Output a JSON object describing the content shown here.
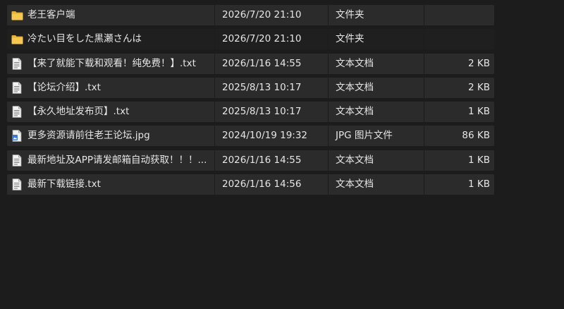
{
  "files": [
    {
      "name": "老王客户端",
      "date": "2026/7/20 21:10",
      "type": "文件夹",
      "size": "",
      "icon": "folder-icon",
      "row_style": "dark"
    },
    {
      "name": "冷たい目をした黒瀬さんは",
      "date": "2026/7/20 21:10",
      "type": "文件夹",
      "size": "",
      "icon": "folder-icon",
      "row_style": "alt"
    },
    {
      "name": "【来了就能下载和观看！纯免费！】.txt",
      "date": "2026/1/16 14:55",
      "type": "文本文档",
      "size": "2 KB",
      "icon": "text-file-icon",
      "row_style": "dark"
    },
    {
      "name": "【论坛介绍】.txt",
      "date": "2025/8/13 10:17",
      "type": "文本文档",
      "size": "2 KB",
      "icon": "text-file-icon",
      "row_style": "dark"
    },
    {
      "name": "【永久地址发布页】.txt",
      "date": "2025/8/13 10:17",
      "type": "文本文档",
      "size": "1 KB",
      "icon": "text-file-icon",
      "row_style": "dark"
    },
    {
      "name": "更多资源请前往老王论坛.jpg",
      "date": "2024/10/19 19:32",
      "type": "JPG 图片文件",
      "size": "86 KB",
      "icon": "image-file-icon",
      "row_style": "dark"
    },
    {
      "name": "最新地址及APP请发邮箱自动获取！！！...",
      "date": "2026/1/16 14:55",
      "type": "文本文档",
      "size": "1 KB",
      "icon": "text-file-icon",
      "row_style": "dark"
    },
    {
      "name": "最新下载链接.txt",
      "date": "2026/1/16 14:56",
      "type": "文本文档",
      "size": "1 KB",
      "icon": "text-file-icon",
      "row_style": "dark"
    }
  ],
  "colors": {
    "background": "#1c1c1c",
    "row": "#2b2b2b",
    "row_alt": "#1f1f1f",
    "text": "#e6e6e6",
    "folder": "#f4c54b",
    "image_icon_accent": "#3b78d8"
  }
}
